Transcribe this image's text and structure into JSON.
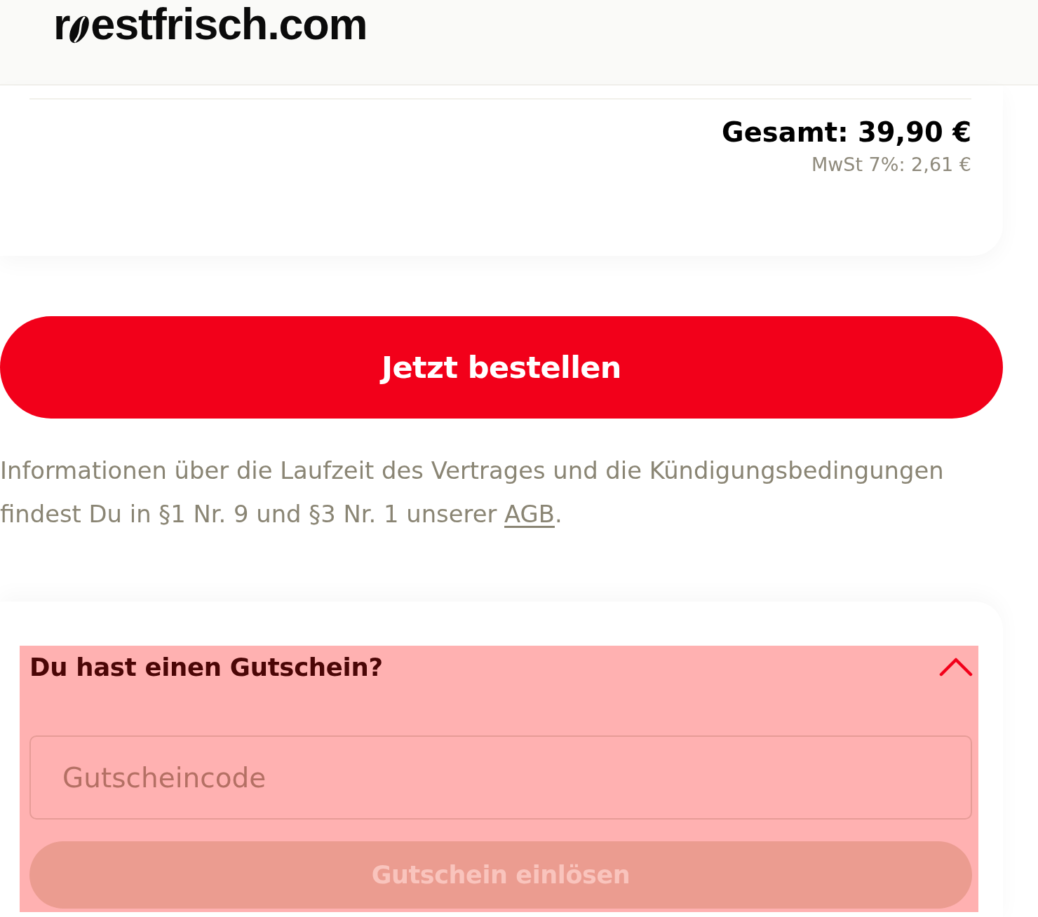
{
  "header": {
    "logo": {
      "start": "r",
      "end": "estfrisch.com"
    }
  },
  "summary": {
    "total": "Gesamt: 39,90 €",
    "vat": "MwSt 7%: 2,61 €"
  },
  "order_button": {
    "label": "Jetzt bestellen"
  },
  "legal_note": {
    "text": "Informationen über die Laufzeit des Vertrages und die Kündigungsbedingungen findest Du in §1 Nr. 9 und §3 Nr. 1 unserer ",
    "link": "AGB",
    "end": "."
  },
  "voucher": {
    "title": "Du hast einen Gutschein?",
    "expanded": true,
    "highlighted": true,
    "input": {
      "placeholder": "Gutscheincode"
    },
    "button": {
      "label": "Gutschein einlösen",
      "disabled": true
    }
  }
}
